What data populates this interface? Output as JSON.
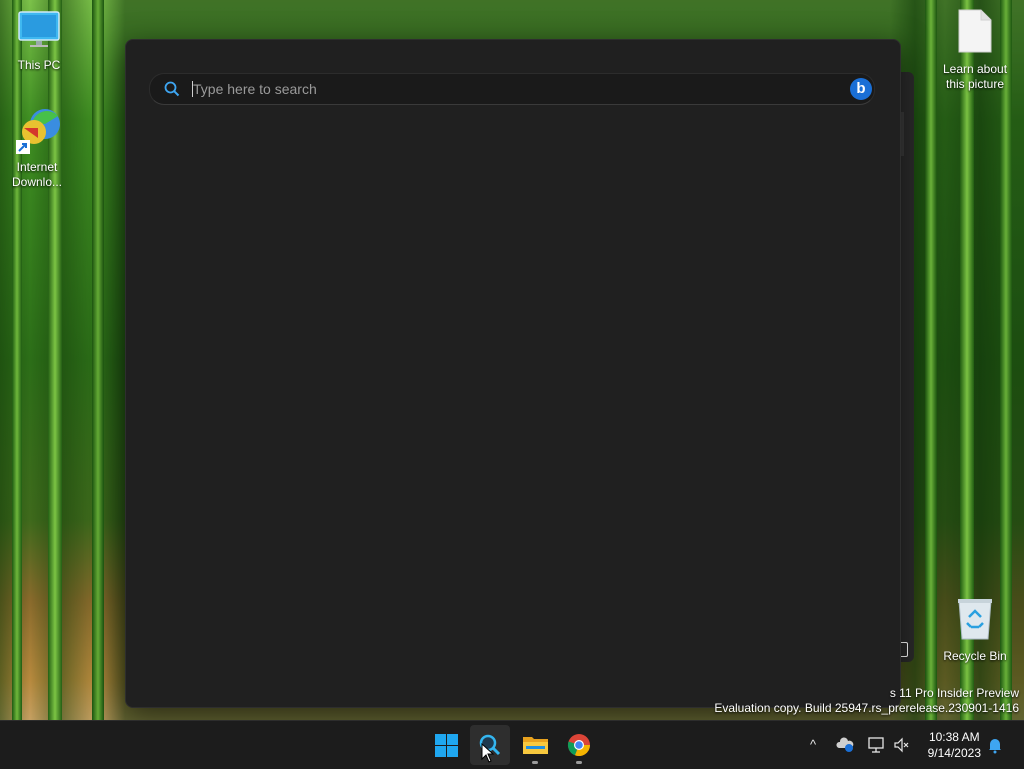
{
  "desktop": {
    "icons": [
      {
        "label": "This PC",
        "icon": "monitor-icon"
      },
      {
        "label": "Internet Downlo...",
        "icon": "internet-download-manager-icon"
      },
      {
        "label": "Learn about this picture",
        "icon": "document-icon"
      },
      {
        "label": "Recycle Bin",
        "icon": "recycle-bin-icon"
      }
    ],
    "watermark": {
      "line1": "s 11 Pro Insider Preview",
      "line2": "Evaluation copy. Build 25947.rs_prerelease.230901-1416"
    }
  },
  "search": {
    "placeholder": "Type here to search",
    "value": "",
    "bing_label": "b"
  },
  "taskbar": {
    "apps": [
      {
        "name": "Start",
        "icon": "windows-logo-icon"
      },
      {
        "name": "Search",
        "icon": "search-icon",
        "active": true
      },
      {
        "name": "File Explorer",
        "icon": "folder-icon"
      },
      {
        "name": "Google Chrome",
        "icon": "chrome-icon"
      }
    ],
    "tray": {
      "chevron": "^",
      "time": "10:38 AM",
      "date": "9/14/2023"
    }
  },
  "colors": {
    "panel_bg": "#202020",
    "taskbar_bg": "#1c1c1c",
    "accent": "#1a6fd6",
    "windows_blue": "#1fa7f0"
  }
}
